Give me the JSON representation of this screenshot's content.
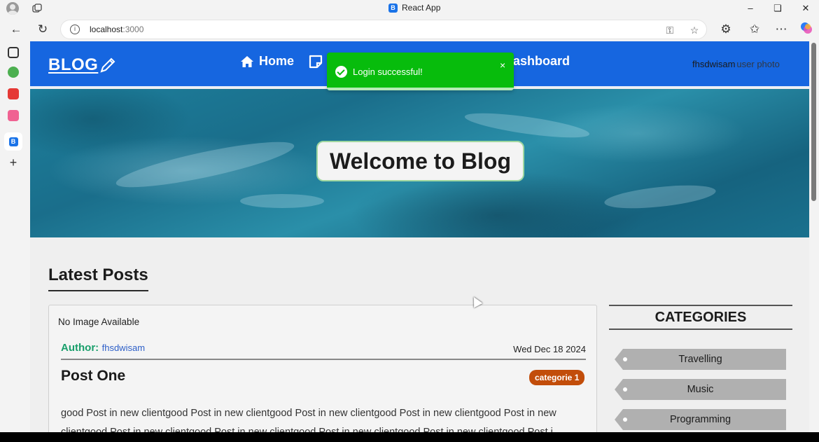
{
  "browser": {
    "tab_title": "React App",
    "tab_favicon": "B",
    "url_host": "localhost",
    "url_port": ":3000"
  },
  "sidebar": {
    "icons": [
      "tabs-icon",
      "extension-icon",
      "youtube-icon",
      "youtube-music-icon",
      "react-app-icon",
      "add-icon"
    ]
  },
  "header": {
    "logo": "BLOG",
    "nav": {
      "home": "Home",
      "dashboard": "ashboard"
    },
    "user_name": "fhsdwisam",
    "user_photo_alt": "user photo"
  },
  "toast": {
    "message": "Login successful!",
    "close": "×",
    "color": "#07bc0c"
  },
  "hero": {
    "title": "Welcome to Blog"
  },
  "latest": {
    "heading": "Latest Posts"
  },
  "post": {
    "image_placeholder": "No Image Available",
    "author_label": "Author:",
    "author_name": "fhsdwisam",
    "date": "Wed Dec 18 2024",
    "title": "Post One",
    "category": "categorie 1",
    "description": "good Post in new clientgood Post in new clientgood Post in new clientgood Post in new clientgood Post in new clientgood Post in new clientgood Post in new clientgood Post in new clientgood Post in new clientgood Post i"
  },
  "categories": {
    "heading": "CATEGORIES",
    "items": [
      "Travelling",
      "Music",
      "Programming"
    ]
  },
  "colors": {
    "header_bg": "#1666e0",
    "author_label": "#199f6b",
    "badge": "#c24d0a"
  }
}
